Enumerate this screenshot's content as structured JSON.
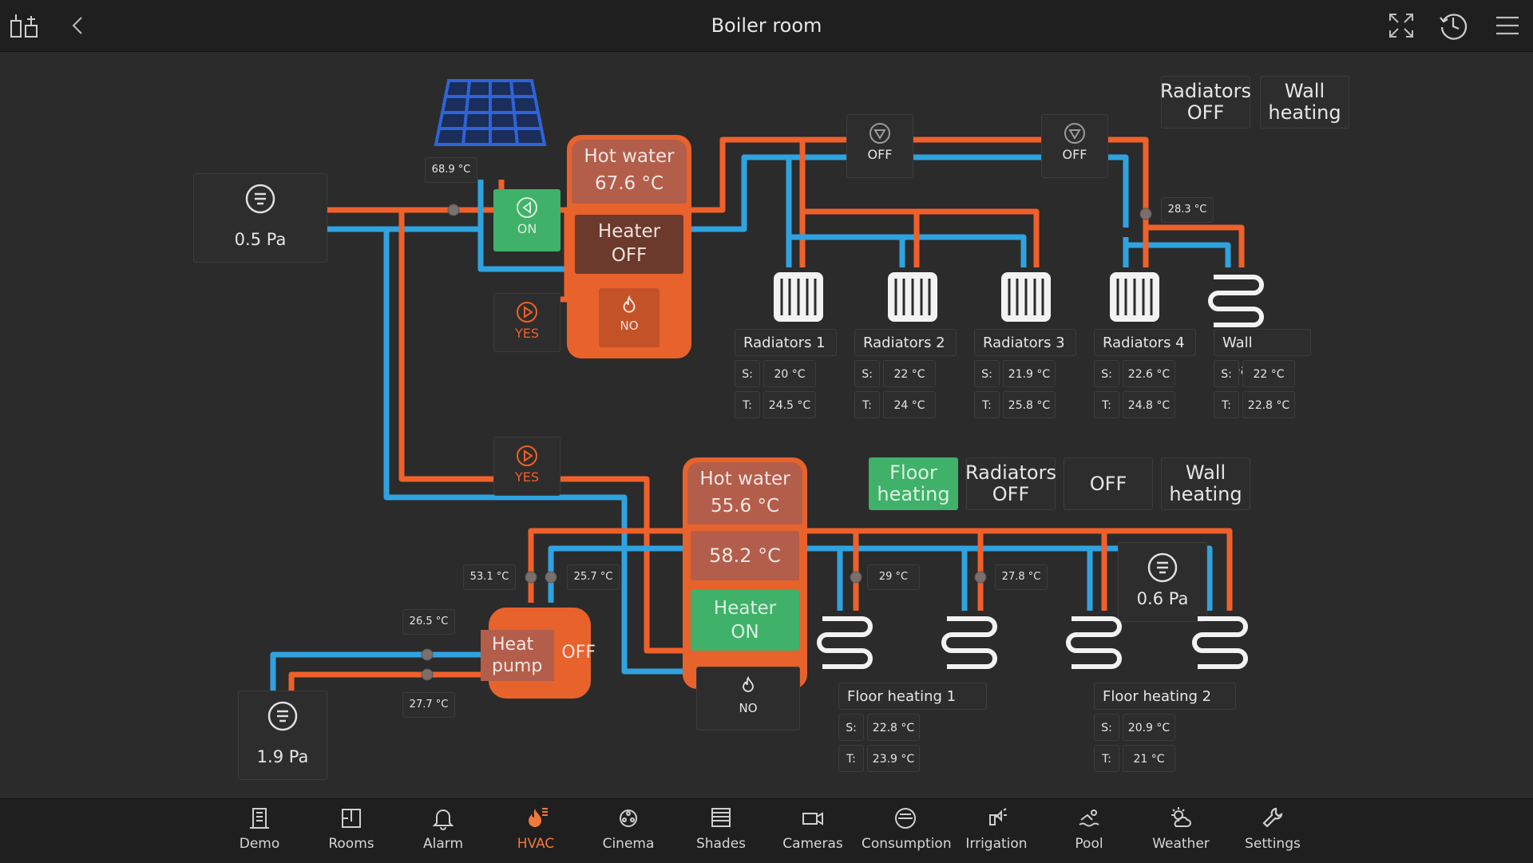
{
  "header": {
    "title": "Boiler room"
  },
  "colors": {
    "hot": "#f0602a",
    "cold": "#2fa3e0",
    "active_green": "#3fb169",
    "tank": "#e8622c",
    "accent": "#f0793c"
  },
  "icons": {
    "home": "home-switch-icon",
    "back": "chevron-left-icon",
    "fullscreen": "fullscreen-icon",
    "history": "history-icon",
    "menu": "hamburger-menu-icon"
  },
  "upper": {
    "pump_pressure": "0.5 Pa",
    "solar_temp": "68.9 °C",
    "solar_valve": "ON",
    "solar_pump": "YES",
    "tank_label": "Hot water",
    "tank_temp": "67.6 °C",
    "heater_line1": "Heater",
    "heater_line2": "OFF",
    "flame_state": "NO",
    "mix_valve_1": "OFF",
    "mix_valve_2": "OFF",
    "sensor_temp": "28.3 °C",
    "btn_radiators": "Radiators OFF",
    "btn_wall": "Wall heating"
  },
  "circuits_top": [
    {
      "name": "Radiators 1",
      "s_key": "S:",
      "t_key": "T:",
      "s": "20 °C",
      "t": "24.5 °C"
    },
    {
      "name": "Radiators 2",
      "s_key": "S:",
      "t_key": "T:",
      "s": "22 °C",
      "t": "24 °C"
    },
    {
      "name": "Radiators 3",
      "s_key": "S:",
      "t_key": "T:",
      "s": "21.9 °C",
      "t": "25.8 °C"
    },
    {
      "name": "Radiators 4",
      "s_key": "S:",
      "t_key": "T:",
      "s": "22.6 °C",
      "t": "24.8 °C"
    },
    {
      "name": "Wall heating",
      "s_key": "S:",
      "t_key": "T:",
      "s": "22 °C",
      "t": "22.8 °C"
    }
  ],
  "lower": {
    "pump2": "YES",
    "tank_label": "Hot water",
    "tank_temp": "55.6 °C",
    "inner_temp": "58.2 °C",
    "heater_line1": "Heater",
    "heater_line2": "ON",
    "flame_state": "NO",
    "hp_temp_hot": "53.1 °C",
    "hp_temp_cold": "25.7 °C",
    "hp_temp_a": "26.5 °C",
    "hp_temp_b": "27.7 °C",
    "hp_label_1": "Heat",
    "hp_label_2": "pump",
    "hp_state": "OFF",
    "pump_pressure": "1.9 Pa",
    "fh_temp_1": "29 °C",
    "fh_temp_2": "27.8 °C",
    "fh_pressure": "0.6 Pa",
    "btn_floor": "Floor heating",
    "btn_radiators": "Radiators OFF",
    "btn_off": "OFF",
    "btn_wall": "Wall heating"
  },
  "circuits_bottom": [
    {
      "name": "Floor heating 1",
      "s_key": "S:",
      "t_key": "T:",
      "s": "22.8 °C",
      "t": "23.9 °C"
    },
    {
      "name": "Floor heating 2",
      "s_key": "S:",
      "t_key": "T:",
      "s": "20.9 °C",
      "t": "21 °C"
    }
  ],
  "nav": [
    {
      "label": "Demo",
      "icon": "building-icon"
    },
    {
      "label": "Rooms",
      "icon": "floorplan-icon"
    },
    {
      "label": "Alarm",
      "icon": "bell-icon"
    },
    {
      "label": "HVAC",
      "icon": "flame-icon",
      "active": true
    },
    {
      "label": "Cinema",
      "icon": "film-reel-icon"
    },
    {
      "label": "Shades",
      "icon": "blinds-icon"
    },
    {
      "label": "Cameras",
      "icon": "camera-icon"
    },
    {
      "label": "Consumption",
      "icon": "meter-icon"
    },
    {
      "label": "Irrigation",
      "icon": "sprinkler-icon"
    },
    {
      "label": "Pool",
      "icon": "swimmer-icon"
    },
    {
      "label": "Weather",
      "icon": "sun-cloud-icon"
    },
    {
      "label": "Settings",
      "icon": "wrench-icon"
    }
  ]
}
